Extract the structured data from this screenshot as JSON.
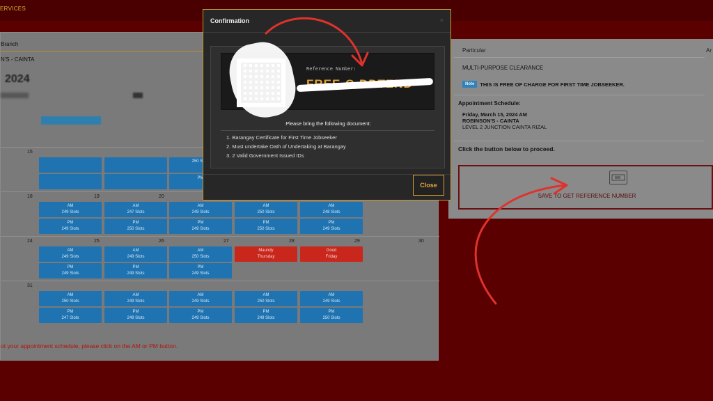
{
  "topbar": {
    "nav_text": "ERVICES"
  },
  "left": {
    "branch_label": "Branch",
    "branch_value": "N'S - CAINTA",
    "year": "2024",
    "calendar": {
      "rows": [
        {
          "days": [
            "15",
            "",
            "",
            "",
            "",
            "",
            ""
          ],
          "slots": [
            {
              "col": 0,
              "am": "",
              "pm": ""
            },
            {
              "col": 1,
              "am": "",
              "pm": ""
            },
            {
              "col": 2,
              "am": "250 Slots",
              "pm": "PM"
            }
          ]
        },
        {
          "days": [
            "18",
            "19",
            "20",
            "21",
            "22",
            "",
            ""
          ],
          "slots": [
            {
              "col": 0,
              "am": "AM\n249 Slots",
              "pm": "PM\n249 Slots"
            },
            {
              "col": 1,
              "am": "AM\n247 Slots",
              "pm": "PM\n250 Slots"
            },
            {
              "col": 2,
              "am": "AM\n249 Slots",
              "pm": "PM\n249 Slots"
            },
            {
              "col": 3,
              "am": "AM\n250 Slots",
              "pm": "PM\n250 Slots"
            },
            {
              "col": 4,
              "am": "AM\n248 Slots",
              "pm": "PM\n249 Slots"
            }
          ]
        },
        {
          "days": [
            "24",
            "25",
            "26",
            "27",
            "28",
            "29",
            "30"
          ],
          "slots": [
            {
              "col": 0,
              "am": "AM\n249 Slots",
              "pm": "PM\n249 Slots"
            },
            {
              "col": 1,
              "am": "AM\n249 Slots",
              "pm": "PM\n249 Slots"
            },
            {
              "col": 2,
              "am": "AM\n250 Slots",
              "pm": "PM\n249 Slots"
            }
          ],
          "holidays": [
            {
              "col": 3,
              "label": "Maundy\nThursday"
            },
            {
              "col": 4,
              "label": "Good\nFriday"
            }
          ]
        },
        {
          "days": [
            "31",
            "",
            "",
            "",
            "",
            "",
            ""
          ],
          "slots": [
            {
              "col": 0,
              "am": "AM\n250 Slots",
              "pm": "PM\n247 Slots"
            },
            {
              "col": 1,
              "am": "AM\n249 Slots",
              "pm": "PM\n249 Slots"
            },
            {
              "col": 2,
              "am": "AM\n249 Slots",
              "pm": "PM\n249 Slots"
            },
            {
              "col": 3,
              "am": "AM\n250 Slots",
              "pm": "PM\n249 Slots"
            },
            {
              "col": 4,
              "am": "AM\n249 Slots",
              "pm": "PM\n250 Slots"
            }
          ]
        }
      ]
    },
    "footer": "ot your appointment schedule, please click on the AM or PM button."
  },
  "right": {
    "col_particular": "Particular",
    "col_amount": "Ar",
    "particular_value": "MULTI-PURPOSE CLEARANCE",
    "note_badge": "Note",
    "note_text": "THIS IS FREE OF CHARGE FOR FIRST TIME JOBSEEKER.",
    "schedule_label": "Appointment Schedule:",
    "schedule_date": "Friday, March 15, 2024 AM",
    "schedule_branch": "ROBINSON'S - CAINTA",
    "schedule_address": "LEVEL 2 JUNCTION CAINTA RIZAL",
    "proceed_text": "Click the button below to proceed.",
    "save_button": "SAVE TO GET REFERENCE NUMBER"
  },
  "modal": {
    "title": "Confirmation",
    "close_x": "×",
    "reference_label": "Reference Number:",
    "reference_value": "FREE-C-DDTEND",
    "bring_text": "Please bring the following document:",
    "documents": [
      "1. Barangay Certificate for First Time Jobseeker",
      "2. Must undertake Oath of Undertaking at Barangay",
      "3. 2 Valid Government Issued IDs"
    ],
    "close_button": "Close"
  },
  "colors": {
    "accent_gold": "#d9a130",
    "slot_blue": "#1f73b1",
    "holiday_red": "#c9261c",
    "annotation_red": "#e0322c"
  }
}
